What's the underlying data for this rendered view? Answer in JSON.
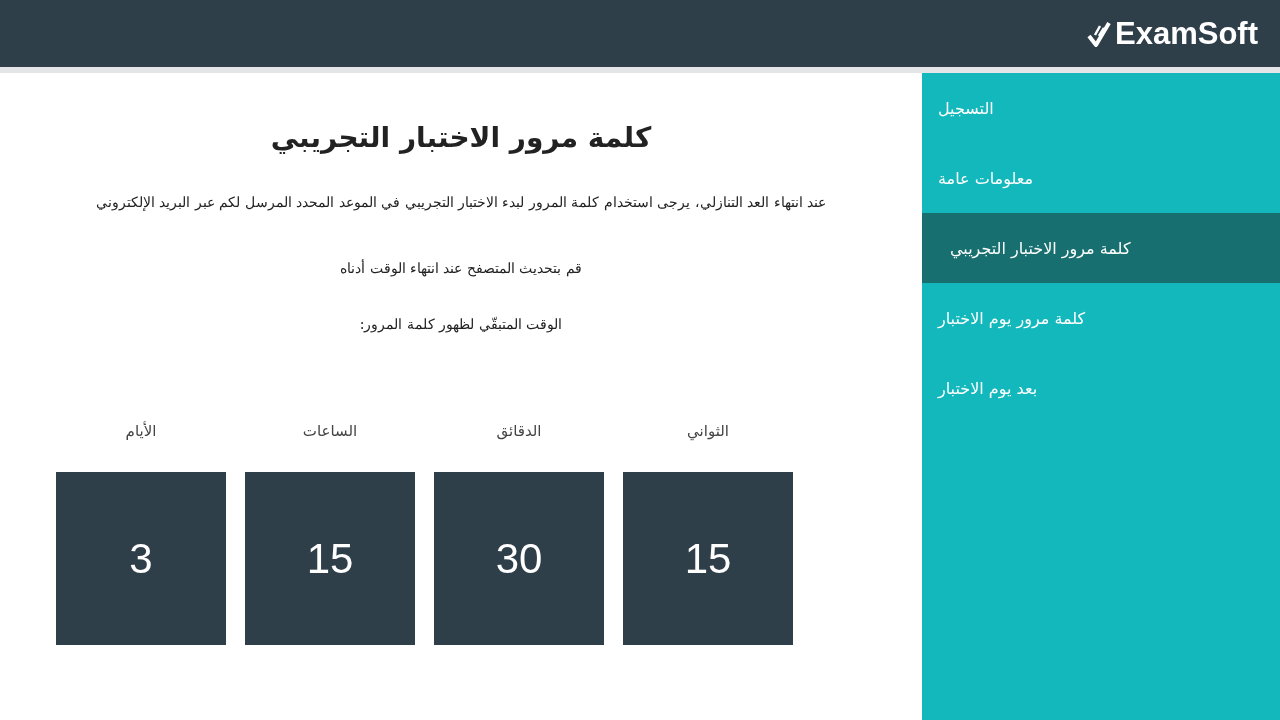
{
  "header": {
    "logo": "ExamSoft"
  },
  "main": {
    "title": "كلمة مرور الاختبار التجريبي",
    "paragraphs": [
      "عند انتهاء العد التنازلي، يرجى استخدام كلمة المرور لبدء الاختبار التجريبي في الموعد المحدد المرسل لكم عبر البريد الإلكتروني",
      "قم بتحديث المتصفح عند انتهاء الوقت أدناه",
      "الوقت المتبقّي لظهور كلمة المرور:"
    ],
    "countdown": [
      {
        "label": "الثواني",
        "value": "15"
      },
      {
        "label": "الدقائق",
        "value": "30"
      },
      {
        "label": "الساعات",
        "value": "15"
      },
      {
        "label": "الأيام",
        "value": "3"
      }
    ]
  },
  "sidebar": {
    "items": [
      {
        "label": "التسجيل",
        "selected": false
      },
      {
        "label": "معلومات عامة",
        "selected": false
      },
      {
        "label": "كلمة مرور الاختبار التجريبي",
        "selected": true
      },
      {
        "label": "كلمة مرور يوم الاختبار",
        "selected": false
      },
      {
        "label": "بعد يوم الاختبار",
        "selected": false
      }
    ]
  }
}
